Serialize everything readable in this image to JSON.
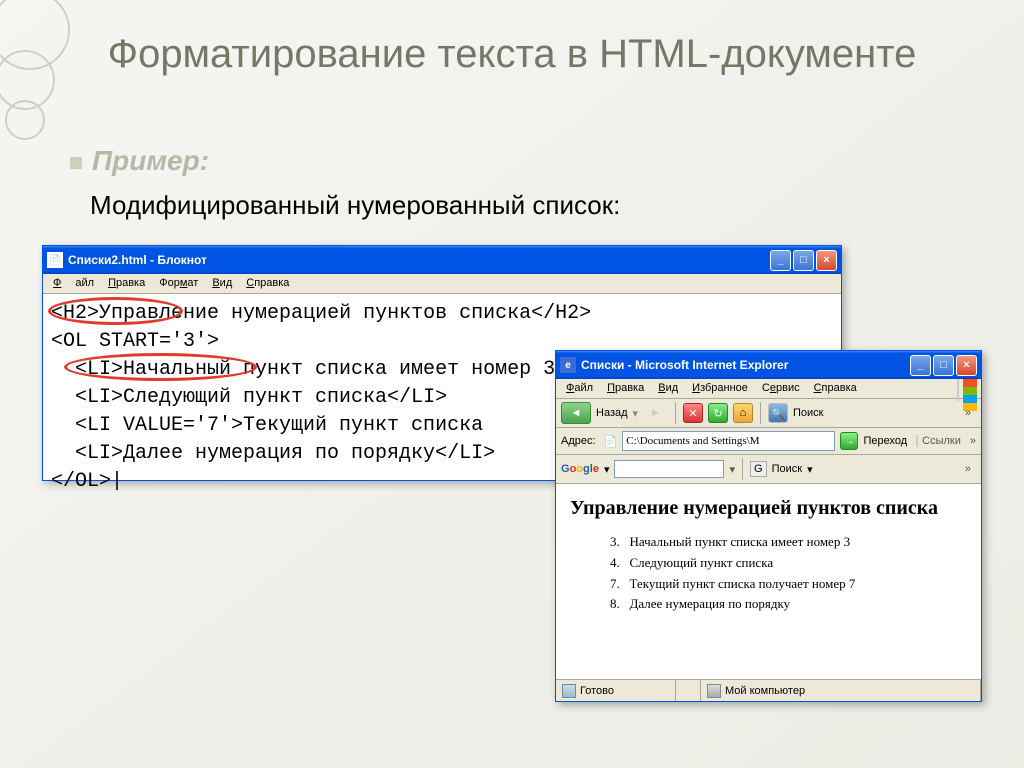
{
  "slide": {
    "title": "Форматирование текста в HTML-документе",
    "example_label": "Пример:",
    "subtitle": "Модифицированный нумерованный список:"
  },
  "notepad": {
    "title": "Списки2.html - Блокнот",
    "menu": {
      "file": "Файл",
      "edit": "Правка",
      "format": "Формат",
      "view": "Вид",
      "help": "Справка"
    },
    "code": {
      "l1a": "<H2>",
      "l1b": "Управление",
      "l1c": " нумерацией пунктов списка</H2>",
      "l2": "<OL START='3'>",
      "l3": "  <LI>Начальный пункт списка имеет номер 3</LI>",
      "l4a": "  <LI>Следующий",
      "l4b": " пункт списка</LI>",
      "l5": "  <LI VALUE='7'>Текущий пункт списка",
      "l6": "  <LI>Далее нумерация по порядку</LI>",
      "l7": "</OL>"
    }
  },
  "ie": {
    "title": "Списки - Microsoft Internet Explorer",
    "menu": {
      "file": "Файл",
      "edit": "Правка",
      "view": "Вид",
      "fav": "Избранное",
      "tools": "Сервис",
      "help": "Справка"
    },
    "nav": {
      "back": "Назад",
      "search": "Поиск"
    },
    "addr": {
      "label": "Адрес:",
      "value": "C:\\Documents and Settings\\М",
      "go": "Переход",
      "links": "Ссылки"
    },
    "google": {
      "logo": "Google",
      "dropdown": "▼",
      "search_btn": "Поиск"
    },
    "content": {
      "heading": "Управление нумерацией пунктов списка",
      "items": [
        {
          "n": "3",
          "t": "Начальный пункт списка имеет номер 3"
        },
        {
          "n": "4",
          "t": "Следующий пункт списка"
        },
        {
          "n": "7",
          "t": "Текущий пункт списка получает номер 7"
        },
        {
          "n": "8",
          "t": "Далее нумерация по порядку"
        }
      ]
    },
    "status": {
      "ready": "Готово",
      "zone": "Мой компьютер"
    }
  }
}
